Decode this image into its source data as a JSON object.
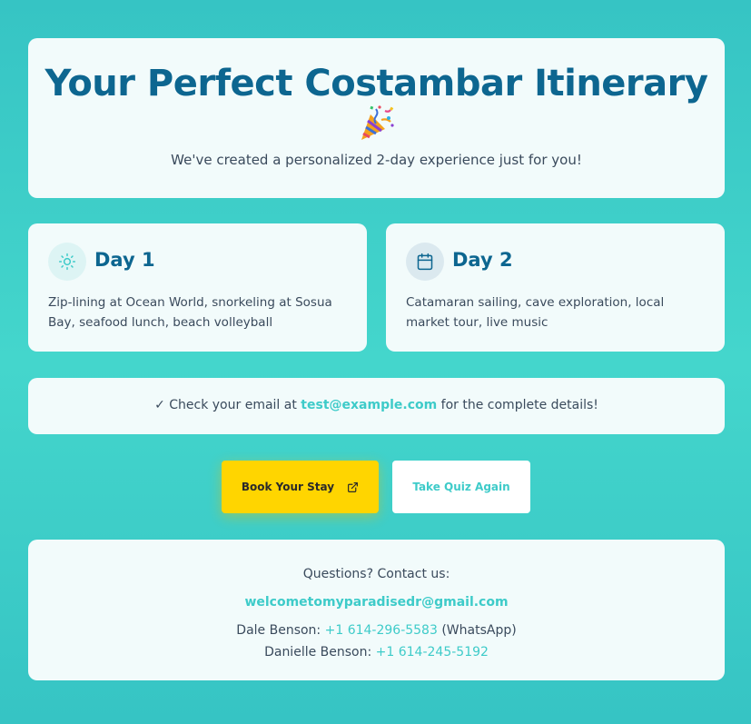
{
  "header": {
    "title": "Your Perfect Costambar Itinerary",
    "emoji_icon": "party-popper-icon",
    "subtitle": "We've created a personalized 2-day experience just for you!"
  },
  "days": [
    {
      "icon": "sun-icon",
      "title": "Day 1",
      "description": "Zip-lining at Ocean World, snorkeling at Sosua Bay, seafood lunch, beach volleyball"
    },
    {
      "icon": "calendar-icon",
      "title": "Day 2",
      "description": "Catamaran sailing, cave exploration, local market tour, live music"
    }
  ],
  "email_notice": {
    "prefix": "✓ Check your email at ",
    "email": "test@example.com",
    "suffix": " for the complete details!"
  },
  "buttons": {
    "book_label": "Book Your Stay",
    "book_icon": "external-link-icon",
    "quiz_label": "Take Quiz Again"
  },
  "contact": {
    "heading": "Questions? Contact us:",
    "email": "welcometomyparadisedr@gmail.com",
    "person1_label": "Dale Benson: ",
    "person1_phone": "+1 614-296-5583",
    "person1_note": " (WhatsApp)",
    "person2_label": "Danielle Benson: ",
    "person2_phone": "+1 614-245-5192"
  },
  "colors": {
    "background": "#3cccc8",
    "heading": "#0d6690",
    "accent": "#3ecbc9",
    "book_button": "#ffd500",
    "card": "#f2fbfb"
  }
}
